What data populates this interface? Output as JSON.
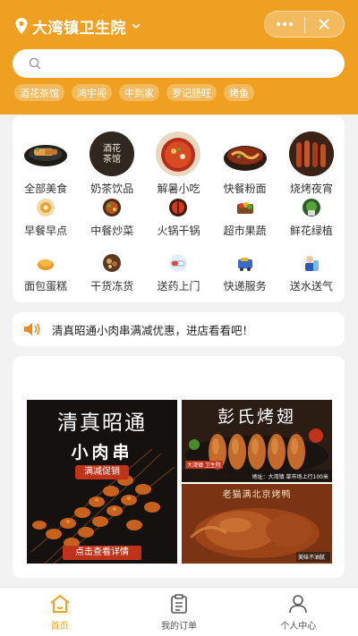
{
  "header": {
    "location": "大湾镇卫生院",
    "search_placeholder": "",
    "tags": [
      "酒花茶馆",
      "鸿宇阁",
      "牛到家",
      "罗记肠旺",
      "烤鱼"
    ]
  },
  "categories": {
    "featured": [
      {
        "label": "全部美食",
        "icon": "food-plate-icon"
      },
      {
        "label": "奶茶饮品",
        "icon": "milk-tea-icon",
        "badge": "酒花\n茶馆"
      },
      {
        "label": "解暑小吃",
        "icon": "snack-bowl-icon"
      },
      {
        "label": "快餐粉面",
        "icon": "noodles-icon"
      },
      {
        "label": "烧烤夜宵",
        "icon": "bbq-skewer-icon"
      }
    ],
    "row2": [
      {
        "label": "早餐早点",
        "icon": "breakfast-icon"
      },
      {
        "label": "中餐炒菜",
        "icon": "stir-fry-icon"
      },
      {
        "label": "火锅干锅",
        "icon": "hotpot-icon"
      },
      {
        "label": "超市果蔬",
        "icon": "supermarket-icon"
      },
      {
        "label": "鲜花绿植",
        "icon": "plant-icon"
      }
    ],
    "row3": [
      {
        "label": "面包蛋糕",
        "icon": "bread-icon"
      },
      {
        "label": "干货冻货",
        "icon": "dry-goods-icon"
      },
      {
        "label": "送药上门",
        "icon": "medicine-icon"
      },
      {
        "label": "快递服务",
        "icon": "delivery-icon"
      },
      {
        "label": "送水送气",
        "icon": "water-gas-icon"
      }
    ]
  },
  "notice": {
    "text": "清真昭通小肉串满减优惠，进店看看吧！"
  },
  "promos": {
    "left": {
      "title_line1": "清真昭通",
      "title_line2": "小肉串",
      "badge": "满减促销",
      "cta": "点击查看详情"
    },
    "top_right": {
      "title": "彭氏烤翅",
      "tag": "大湾镇 卫生院",
      "address": "地址：大湾镇 菜市场上行100米"
    },
    "bottom_right": {
      "title": "老猫满北京烤鸭",
      "tag": "美味不油腻"
    }
  },
  "tabbar": {
    "items": [
      {
        "label": "首页",
        "icon": "home-icon",
        "active": true
      },
      {
        "label": "我的订单",
        "icon": "orders-icon",
        "active": false
      },
      {
        "label": "个人中心",
        "icon": "profile-icon",
        "active": false
      }
    ]
  },
  "colors": {
    "accent": "#f0a020",
    "bg": "#f2f2f2"
  }
}
